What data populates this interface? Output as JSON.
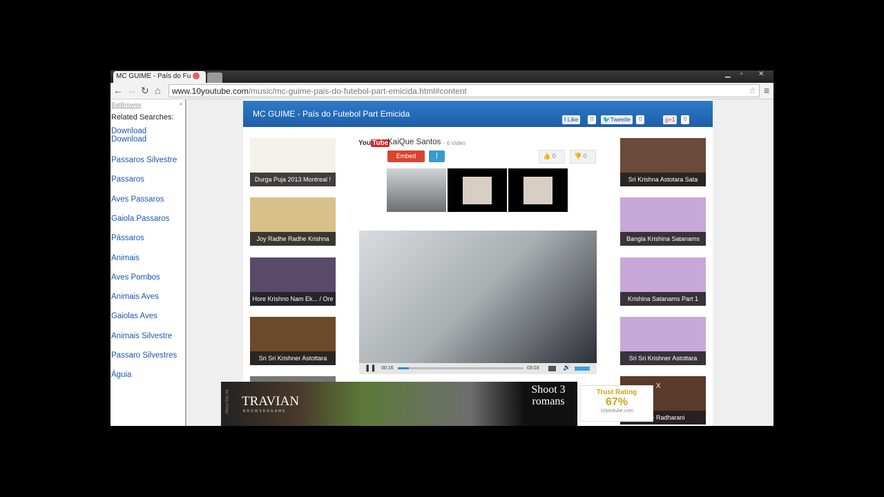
{
  "browser": {
    "tab_title": "MC GUIME - País do Fu",
    "url_domain": "www.10youtube.com",
    "url_path": "/music/mc-guime-pais-do-futebol-part-emicida.html#content"
  },
  "sidebar": {
    "brand": "BatBrowse",
    "close": "×",
    "heading": "Related Searches:",
    "links": [
      "Download Download",
      "Passaros Silvestre",
      "Passaros",
      "Aves Passaros",
      "Gaiola Passaros",
      "Pássaros",
      "Animais",
      "Aves Pombos",
      "Animais Aves",
      "Gaiolas Aves",
      "Animais Silvestre",
      "Passaro Silvestres",
      "Águia"
    ]
  },
  "page": {
    "title": "MC GUIME - País do Futebol Part Emicida",
    "social": {
      "like": "Like",
      "like_count": "0",
      "tweet": "Tweetle",
      "tweet_count": "0",
      "gplus": "g+1",
      "gplus_count": "0"
    },
    "channel": {
      "logo": "YouTube",
      "name": "KaiQue Santos",
      "count": "- 6 Video"
    },
    "embed_label": "Embed",
    "report_label": "!",
    "likes": "0",
    "dislikes": "0",
    "left_videos": [
      "Durga Puja 2013 Montreal !",
      "Joy Radhe Radhe Krishna",
      "Hore Krishno Nam Ek... / Ore",
      "Sri Sri Krishner Astottara"
    ],
    "right_videos": [
      "Sri Krishna Astotara Sata",
      "Bangla Krishina Satanams",
      "Krishina Satanams Part 1",
      "Sri Sri Krishner Astottara",
      "sini - Radharani"
    ],
    "player": {
      "current": "00:16",
      "duration": "03:03",
      "progress_percent": 9
    }
  },
  "ad": {
    "brand": "TRAVIAN",
    "sub": "BROWSERGAME",
    "tagline": "Shoot 3 romans",
    "about": "About this Ad",
    "close": "X"
  },
  "trust": {
    "label": "Trust Rating",
    "value": "67%",
    "site": "10youtube.com"
  }
}
